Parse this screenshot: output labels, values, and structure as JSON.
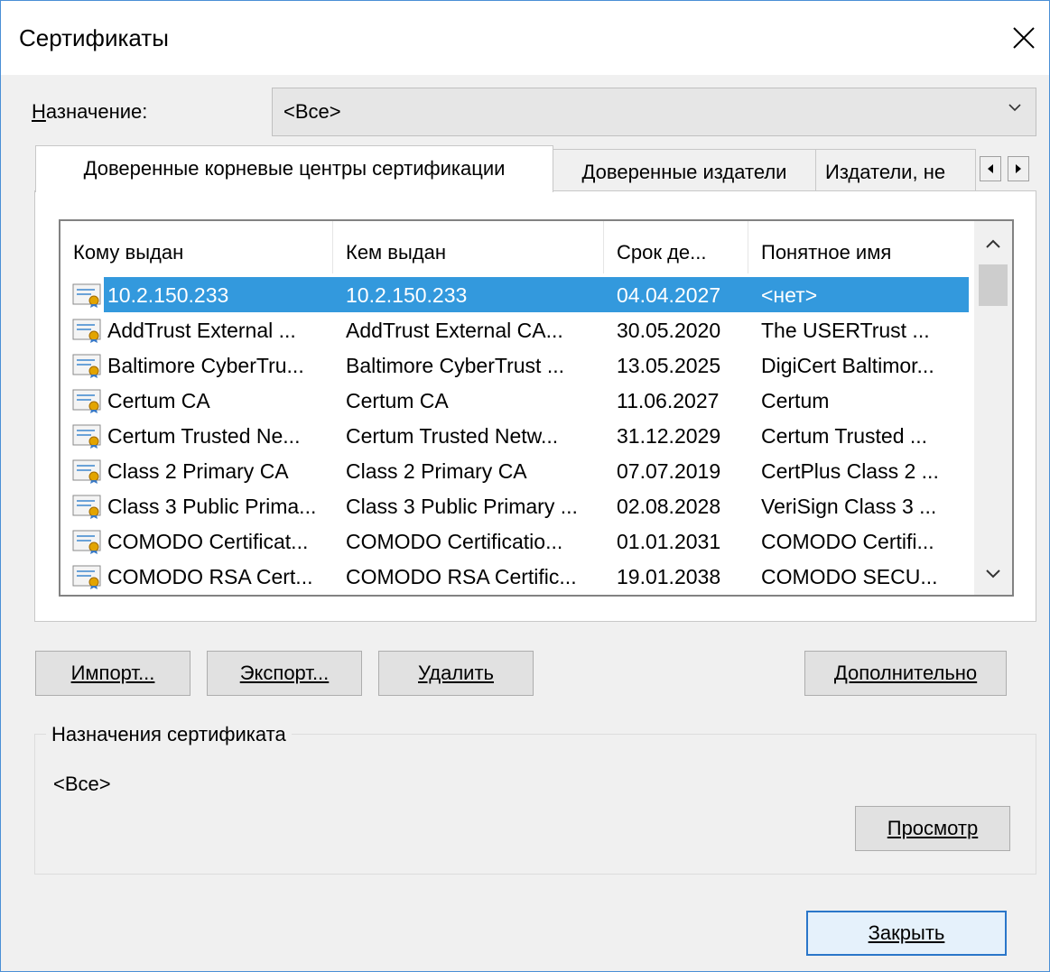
{
  "window": {
    "title": "Сертификаты"
  },
  "purpose": {
    "label": "Назначение:",
    "value": "<Все>"
  },
  "tabs": [
    {
      "label": "Доверенные корневые центры сертификации",
      "active": true
    },
    {
      "label": "Доверенные издатели",
      "active": false
    },
    {
      "label": "Издатели, не",
      "active": false
    }
  ],
  "list": {
    "columns": [
      "Кому выдан",
      "Кем выдан",
      "Срок де...",
      "Понятное имя"
    ],
    "rows": [
      {
        "issued_to": "10.2.150.233",
        "issued_by": "10.2.150.233",
        "expires": "04.04.2027",
        "friendly": "<нет>",
        "selected": true
      },
      {
        "issued_to": "AddTrust External ...",
        "issued_by": "AddTrust External CA...",
        "expires": "30.05.2020",
        "friendly": "The USERTrust ..."
      },
      {
        "issued_to": "Baltimore CyberTru...",
        "issued_by": "Baltimore CyberTrust ...",
        "expires": "13.05.2025",
        "friendly": "DigiCert Baltimor..."
      },
      {
        "issued_to": "Certum CA",
        "issued_by": "Certum CA",
        "expires": "11.06.2027",
        "friendly": "Certum"
      },
      {
        "issued_to": "Certum Trusted Ne...",
        "issued_by": "Certum Trusted Netw...",
        "expires": "31.12.2029",
        "friendly": "Certum Trusted ..."
      },
      {
        "issued_to": "Class 2 Primary CA",
        "issued_by": "Class 2 Primary CA",
        "expires": "07.07.2019",
        "friendly": "CertPlus Class 2 ..."
      },
      {
        "issued_to": "Class 3 Public Prima...",
        "issued_by": "Class 3 Public Primary ...",
        "expires": "02.08.2028",
        "friendly": "VeriSign Class 3 ..."
      },
      {
        "issued_to": "COMODO Certificat...",
        "issued_by": "COMODO Certificatio...",
        "expires": "01.01.2031",
        "friendly": "COMODO Certifi..."
      },
      {
        "issued_to": "COMODO RSA Cert...",
        "issued_by": "COMODO RSA Certific...",
        "expires": "19.01.2038",
        "friendly": "COMODO SECU..."
      }
    ]
  },
  "buttons": {
    "import": "Импорт...",
    "export": "Экспорт...",
    "delete": "Удалить",
    "advanced": "Дополнительно",
    "view": "Просмотр",
    "close": "Закрыть"
  },
  "cert_purposes": {
    "title": "Назначения сертификата",
    "value": "<Все>"
  },
  "icons": {
    "close": "close-icon",
    "dropdown": "chevron-down-icon",
    "tab_left": "arrow-left-icon",
    "tab_right": "arrow-right-icon",
    "certificate": "certificate-icon"
  },
  "colors": {
    "selection": "#3399dd",
    "default_button_border": "#2a76c9"
  }
}
